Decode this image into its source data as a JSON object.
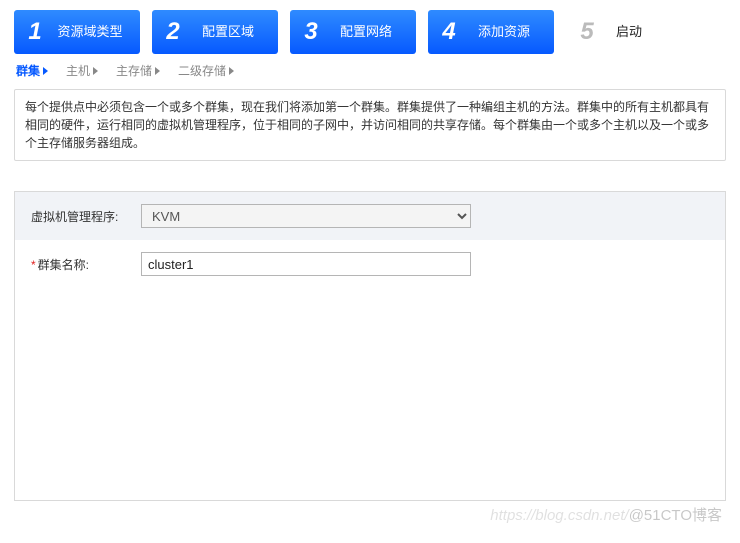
{
  "steps": {
    "items": [
      {
        "num": "1",
        "label": "资源域类型"
      },
      {
        "num": "2",
        "label": "配置区域"
      },
      {
        "num": "3",
        "label": "配置网络"
      },
      {
        "num": "4",
        "label": "添加资源"
      }
    ],
    "disabled": {
      "num": "5",
      "label": "启动"
    }
  },
  "subtabs": {
    "items": [
      {
        "label": "群集",
        "active": true
      },
      {
        "label": "主机",
        "active": false
      },
      {
        "label": "主存储",
        "active": false
      },
      {
        "label": "二级存储",
        "active": false
      }
    ]
  },
  "info": {
    "text": "每个提供点中必须包含一个或多个群集，现在我们将添加第一个群集。群集提供了一种编组主机的方法。群集中的所有主机都具有相同的硬件，运行相同的虚拟机管理程序，位于相同的子网中，并访问相同的共享存储。每个群集由一个或多个主机以及一个或多个主存储服务器组成。"
  },
  "form": {
    "hypervisor": {
      "label": "虚拟机管理程序:",
      "value": "KVM"
    },
    "cluster_name": {
      "label": "群集名称:",
      "value": "cluster1",
      "required_mark": "*"
    }
  },
  "watermark": {
    "a": "https://blog.csdn.net/",
    "b": "@51CTO博客"
  }
}
